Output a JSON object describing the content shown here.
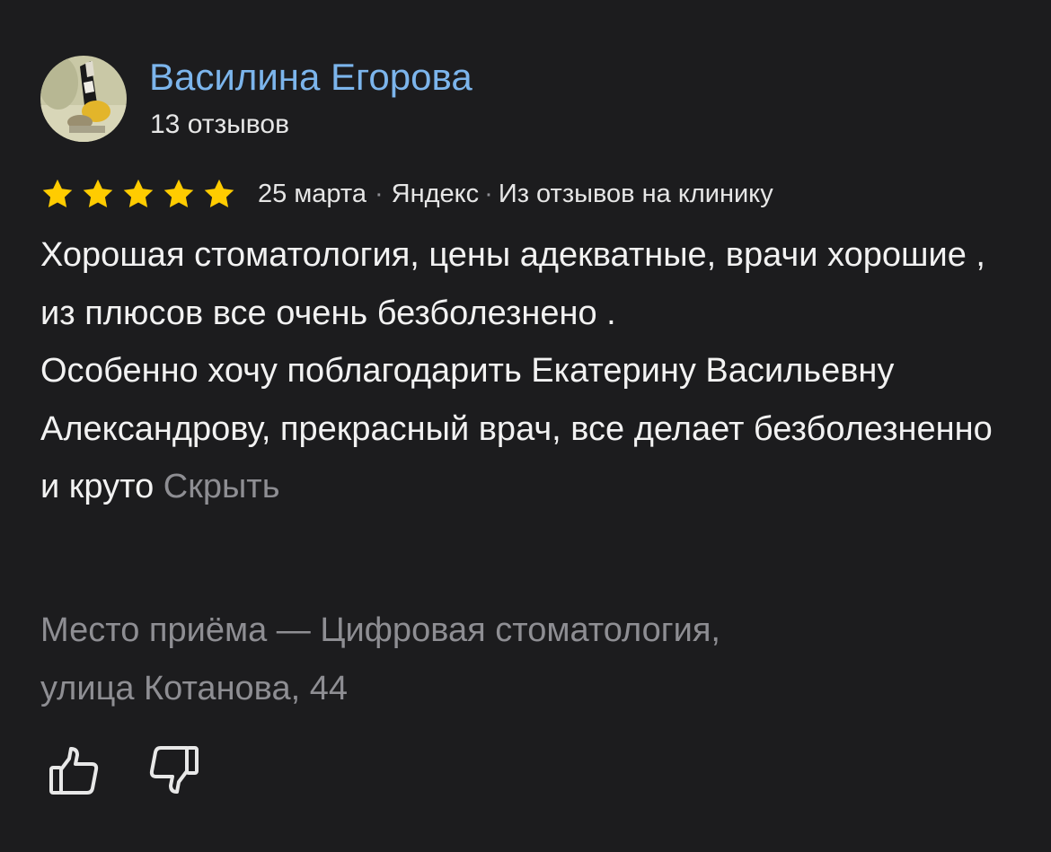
{
  "author": {
    "name": "Василина Егорова",
    "review_count": "13 отзывов",
    "avatar_icon": "user-avatar-photo"
  },
  "review": {
    "rating": 5,
    "rating_max": 5,
    "star_color": "#ffcc00",
    "date": "25 марта",
    "separator": "·",
    "source": "Яндекс",
    "origin": "Из отзывов на клинику",
    "paragraphs": [
      "Хорошая стоматология, цены адекватные, врачи хорошие , из плюсов все очень безболезнено .",
      "Особенно хочу поблагодарить Екатерину Васильевну Александрову, прекрасный врач, все делает безболезненно и круто"
    ],
    "hide_label": "Скрыть"
  },
  "place": {
    "lines": [
      "Место приёма — Цифровая стоматология,",
      "улица Котанова, 44"
    ]
  },
  "actions": {
    "like_icon": "thumbs-up-icon",
    "dislike_icon": "thumbs-down-icon"
  },
  "colors": {
    "background": "#1c1c1e",
    "link": "#7cb5ec",
    "secondary": "#8e8e93"
  }
}
